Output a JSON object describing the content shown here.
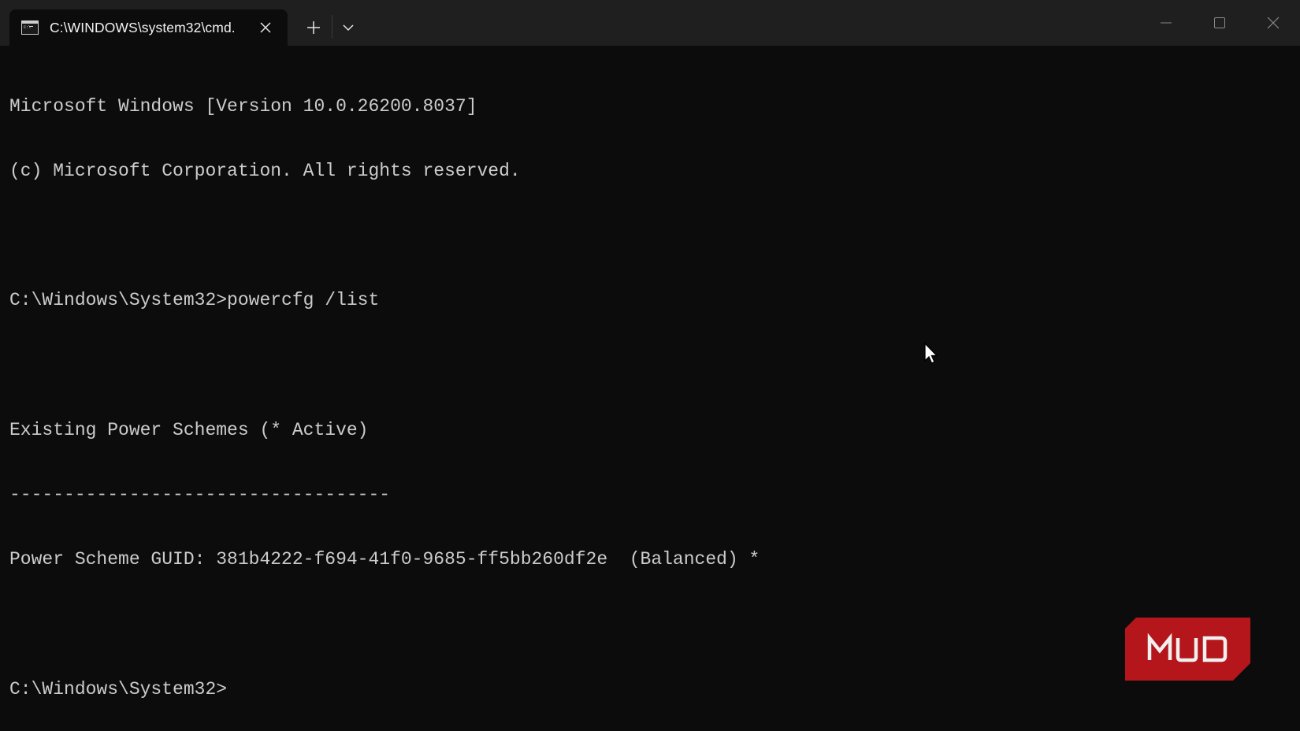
{
  "tab": {
    "title": "C:\\WINDOWS\\system32\\cmd.",
    "icon": "cmd-terminal-icon",
    "close_icon": "close-icon"
  },
  "tabbar": {
    "new_tab_icon": "plus-icon",
    "dropdown_icon": "chevron-down-icon"
  },
  "window_controls": {
    "minimize_icon": "minimize-icon",
    "maximize_icon": "maximize-icon",
    "close_icon": "close-icon"
  },
  "terminal": {
    "lines": [
      "Microsoft Windows [Version 10.0.26200.8037]",
      "(c) Microsoft Corporation. All rights reserved.",
      "",
      "C:\\Windows\\System32>powercfg /list",
      "",
      "Existing Power Schemes (* Active)",
      "-----------------------------------",
      "Power Scheme GUID: 381b4222-f694-41f0-9685-ff5bb260df2e  (Balanced) *",
      "",
      "C:\\Windows\\System32>"
    ]
  },
  "watermark": {
    "text": "MUO",
    "color": "#b5161b"
  },
  "colors": {
    "background": "#0c0c0c",
    "titlebar": "#1f1f1f",
    "text": "#cccccc"
  }
}
